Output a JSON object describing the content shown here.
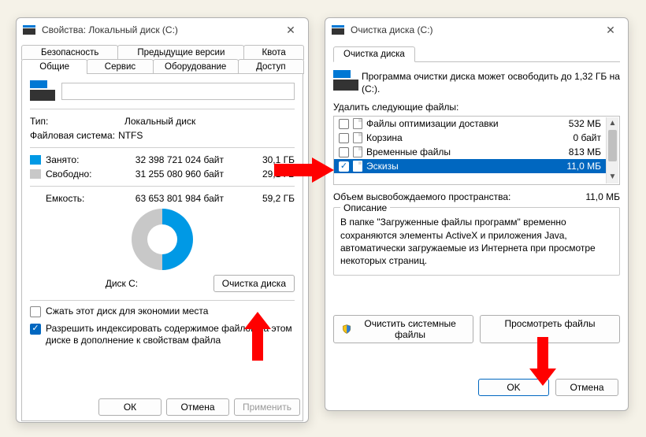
{
  "left": {
    "title": "Свойства: Локальный диск (C:)",
    "tabs_row1": [
      "Безопасность",
      "Предыдущие версии",
      "Квота"
    ],
    "tabs_row2": [
      "Общие",
      "Сервис",
      "Оборудование",
      "Доступ"
    ],
    "active_tab": "Общие",
    "type_label": "Тип:",
    "type_value": "Локальный диск",
    "fs_label": "Файловая система:",
    "fs_value": "NTFS",
    "used": {
      "label": "Занято:",
      "bytes": "32 398 721 024 байт",
      "gb": "30,1 ГБ",
      "swatch": "#0099e5"
    },
    "free": {
      "label": "Свободно:",
      "bytes": "31 255 080 960 байт",
      "gb": "29,1 ГБ",
      "swatch": "#c8c8c8"
    },
    "capacity": {
      "label": "Емкость:",
      "bytes": "63 653 801 984 байт",
      "gb": "59,2 ГБ"
    },
    "disk_label": "Диск C:",
    "cleanup_btn": "Очистка диска",
    "compress": {
      "checked": false,
      "label": "Сжать этот диск для экономии места"
    },
    "index": {
      "checked": true,
      "label": "Разрешить индексировать содержимое файлов на этом диске в дополнение к свойствам файла"
    },
    "ok": "ОК",
    "cancel": "Отмена",
    "apply": "Применить"
  },
  "right": {
    "title": "Очистка диска  (C:)",
    "tab": "Очистка диска",
    "info": "Программа очистки диска может освободить до 1,32 ГБ на  (C:).",
    "list_label": "Удалить следующие файлы:",
    "files": [
      {
        "checked": false,
        "name": "Файлы оптимизации доставки",
        "size": "532 МБ"
      },
      {
        "checked": false,
        "name": "Корзина",
        "size": "0 байт"
      },
      {
        "checked": false,
        "name": "Временные файлы",
        "size": "813 МБ"
      },
      {
        "checked": true,
        "selected": true,
        "name": "Эскизы",
        "size": "11,0 МБ"
      }
    ],
    "freeable_label": "Объем высвобождаемого пространства:",
    "freeable_value": "11,0 МБ",
    "desc_legend": "Описание",
    "desc_text": "В папке \"Загруженные файлы программ\" временно сохраняются элементы ActiveX и приложения Java, автоматически загружаемые из Интернета при просмотре некоторых страниц.",
    "clean_sys": "Очистить системные файлы",
    "view_files": "Просмотреть файлы",
    "ok": "OK",
    "cancel": "Отмена"
  }
}
